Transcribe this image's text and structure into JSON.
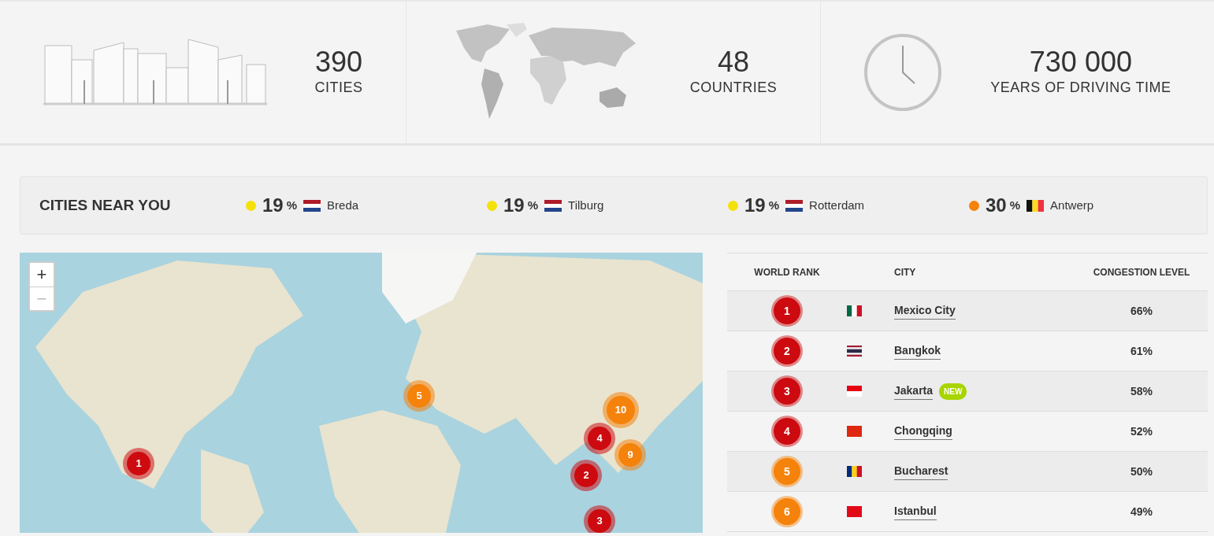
{
  "stats": [
    {
      "kind": "city",
      "value": "390",
      "label": "CITIES"
    },
    {
      "kind": "world",
      "value": "48",
      "label": "COUNTRIES"
    },
    {
      "kind": "clock",
      "value": "730 000",
      "label": "YEARS OF DRIVING TIME"
    }
  ],
  "near_you": {
    "title": "CITIES NEAR YOU",
    "items": [
      {
        "color": "#f5e10a",
        "percent": "19",
        "unit": "%",
        "kind": "nl",
        "city": "Breda"
      },
      {
        "color": "#f5e10a",
        "percent": "19",
        "unit": "%",
        "kind": "nl",
        "city": "Tilburg"
      },
      {
        "color": "#f5e10a",
        "percent": "19",
        "unit": "%",
        "kind": "nl",
        "city": "Rotterdam"
      },
      {
        "color": "#f5820a",
        "percent": "30",
        "unit": "%",
        "kind": "be",
        "city": "Antwerp"
      }
    ]
  },
  "map": {
    "zoom_buttons": [
      {
        "label": "+",
        "disabled": false
      },
      {
        "label": "−",
        "disabled": true
      }
    ],
    "markers": [
      {
        "label": "1",
        "color": "#cc0a0f"
      },
      {
        "label": "2",
        "color": "#cc0a0f"
      },
      {
        "label": "3",
        "color": "#cc0a0f"
      },
      {
        "label": "5",
        "color": "#f5820a"
      },
      {
        "label": "10",
        "color": "#f5820a"
      },
      {
        "label": "4",
        "color": "#cc0a0f"
      },
      {
        "label": "9",
        "color": "#f5820a"
      }
    ]
  },
  "table": {
    "columns": [
      "WORLD RANK",
      "CITY",
      "CONGESTION LEVEL"
    ],
    "rows": [
      {
        "rank": "1",
        "color": "#cc0a0f",
        "kind": "mx",
        "city": "Mexico City",
        "level": "66%"
      },
      {
        "rank": "2",
        "color": "#cc0a0f",
        "kind": "th",
        "city": "Bangkok",
        "level": "61%"
      },
      {
        "rank": "3",
        "color": "#cc0a0f",
        "kind": "id",
        "city": "Jakarta",
        "badge": "NEW",
        "level": "58%"
      },
      {
        "rank": "4",
        "color": "#cc0a0f",
        "kind": "cn",
        "city": "Chongqing",
        "level": "52%"
      },
      {
        "rank": "5",
        "color": "#f5820a",
        "kind": "ro",
        "city": "Bucharest",
        "level": "50%"
      },
      {
        "rank": "6",
        "color": "#f5820a",
        "kind": "tr",
        "city": "Istanbul",
        "level": "49%"
      }
    ]
  }
}
